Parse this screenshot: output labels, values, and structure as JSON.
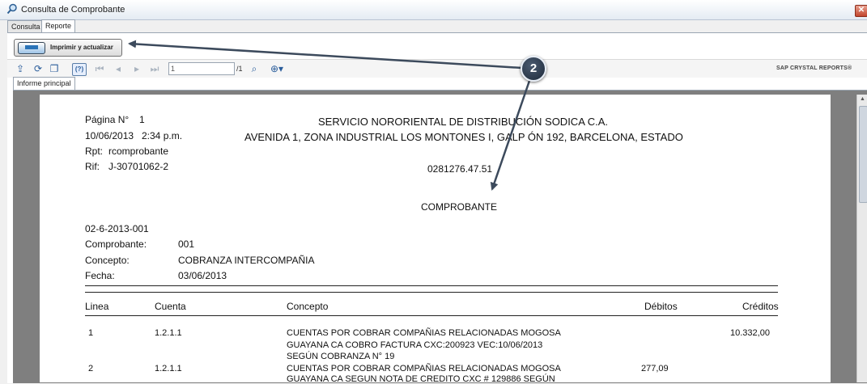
{
  "window": {
    "title": "Consulta de Comprobante",
    "close_icon": "close-icon"
  },
  "tabs": [
    {
      "label": "Consulta",
      "active": false
    },
    {
      "label": "Reporte",
      "active": true
    }
  ],
  "print_button": {
    "label": "Imprimir y actualizar"
  },
  "toolbar": {
    "page_value": "1",
    "page_total": "/1",
    "brand": "SAP CRYSTAL REPORTS®"
  },
  "report_tab": {
    "label": "Informe principal"
  },
  "report": {
    "page_label": "Página N°",
    "page_num": "1",
    "date": "10/06/2013",
    "time": "2:34 p.m.",
    "rpt_label": "Rpt:",
    "rpt_value": "rcomprobante",
    "rif_label": "Rif:",
    "rif_value": "J-30701062-2",
    "company": "SERVICIO NORORIENTAL DE DISTRIBUCIÓN SODICA C.A.",
    "address": "AVENIDA 1, ZONA INDUSTRIAL LOS MONTONES I, GALP ÓN 192, BARCELONA, ESTADO",
    "phone": "0281276.47.51",
    "doc_title": "COMPROBANTE",
    "number": "02-6-2013-001",
    "comprobante_label": "Comprobante:",
    "comprobante_value": "001",
    "concepto_label": "Concepto:",
    "concepto_value": "COBRANZA INTERCOMPAÑIA",
    "fecha_label": "Fecha:",
    "fecha_value": "03/06/2013",
    "columns": {
      "linea": "Linea",
      "cuenta": "Cuenta",
      "concepto": "Concepto",
      "debitos": "Débitos",
      "creditos": "Créditos"
    },
    "rows": [
      {
        "linea": "1",
        "cuenta": "1.2.1.1",
        "concepto": [
          "CUENTAS POR COBRAR COMPAÑIAS RELACIONADAS MOGOSA",
          "GUAYANA CA  COBRO FACTURA CXC:200923 VEC:10/06/2013",
          "SEGÚN COBRANZA N° 19"
        ],
        "debito": "",
        "credito": "10.332,00"
      },
      {
        "linea": "2",
        "cuenta": "1.2.1.1",
        "concepto": [
          "CUENTAS POR COBRAR COMPAÑIAS RELACIONADAS MOGOSA",
          "GUAYANA CA  SEGUN NOTA DE CREDITO CXC # 129886 SEGÚN"
        ],
        "debito": "277,09",
        "credito": ""
      }
    ]
  },
  "callout": {
    "label": "2"
  }
}
